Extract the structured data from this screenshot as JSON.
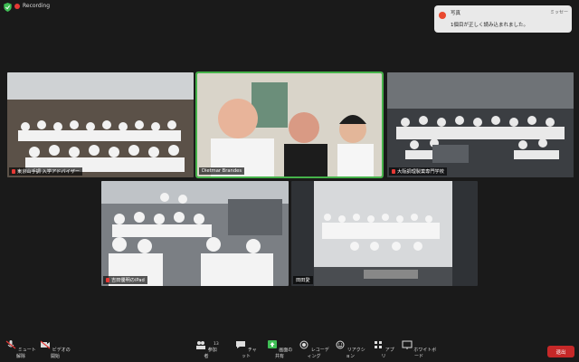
{
  "status": {
    "recording_label": "Recording"
  },
  "notification": {
    "title": "写真",
    "message": "1個目が正しく読み込まれました。",
    "action": "ミッセー"
  },
  "participants": [
    {
      "name": "東京山手調 入学アドバイザー"
    },
    {
      "name": "Dietmar Brandes"
    },
    {
      "name": "大阪調理製菓専門学校"
    },
    {
      "name": "吉田優明のiPad"
    },
    {
      "name": "田田愛"
    }
  ],
  "toolbar": {
    "mute": "ミュート解除",
    "video": "ビデオの開始",
    "participants": "参加者",
    "participants_count": "13",
    "chat": "チャット",
    "share": "画面の共有",
    "record": "レコーディング",
    "reactions": "リアクション",
    "apps": "アプリ",
    "whiteboard": "ホワイトボード",
    "end": "退出"
  },
  "colors": {
    "active_speaker": "#46b24a",
    "end_button": "#c62828",
    "share_green": "#3fbf55"
  }
}
